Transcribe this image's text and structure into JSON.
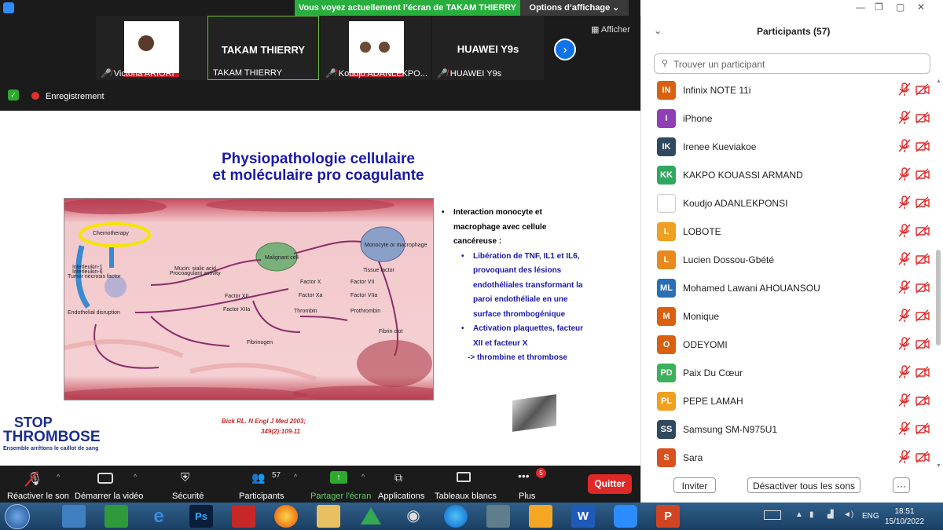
{
  "topbar": {
    "share_banner": "Vous voyez actuellement l’écran de TAKAM THIERRY",
    "view_options": "Options d’affichage"
  },
  "thumbnails": [
    {
      "name": "Victoria ARIORI"
    },
    {
      "name": "TAKAM THIERRY",
      "big": "TAKAM THIERRY"
    },
    {
      "name": "Koudjo ADANLEKPO..."
    },
    {
      "name": "HUAWEI Y9s",
      "big": "HUAWEI Y9s"
    }
  ],
  "afficher": "Afficher",
  "recording": "Enregistrement",
  "slide": {
    "title_line1": "Physiopathologie cellulaire",
    "title_line2": "et moléculaire pro coagulante",
    "diagram_labels": {
      "chemo": "Chemotherapy",
      "il1": "Interleukin-1",
      "il6": "Interleukin-6",
      "tnf": "Tumor necrosis factor",
      "endo": "Endothelial disruption",
      "mucin": "Mucin: sialic acid",
      "procoag": "Procoagulant activity",
      "malignant": "Malignant cell",
      "monocyte": "Monocyte or macrophage",
      "tissue": "Tissue factor",
      "fx": "Factor X",
      "fvii": "Factor VII",
      "fxa": "Factor Xa",
      "fviia": "Factor VIIa",
      "fxii": "Factor XII",
      "fxiia": "Factor XIIa",
      "thrombin": "Thrombin",
      "prothrombin": "Prothrombin",
      "fibrinogen": "Fibrinogen",
      "fibrin": "Fibrin clot"
    },
    "bullet1": "Interaction monocyte et macrophage avec cellule cancéreuse :",
    "sub1": "Libération de TNF, IL1 et IL6, provoquant des lésions endothéliales transformant la paroi endothéliale en une surface thrombogénique",
    "sub2": "Activation plaquettes, facteur XII et facteur X",
    "arrow_text": "-> thrombine et thrombose",
    "citation1": "Bick RL. N Engl J Med 2003;",
    "citation2": "349(2):109-11",
    "logo_line1": "STOP",
    "logo_line2": "THROMBOSE",
    "logo_tagline": "Ensemble arrêtons le caillot de sang"
  },
  "toolbar": {
    "mute": "Réactiver le son",
    "video": "Démarrer la vidéo",
    "security": "Sécurité",
    "participants": "Participants",
    "participants_count": "57",
    "share": "Partager l'écran",
    "apps": "Applications",
    "whiteboards": "Tableaux blancs",
    "more": "Plus",
    "more_badge": "5",
    "quit": "Quitter"
  },
  "panel": {
    "title": "Participants (57)",
    "search_placeholder": "Trouver un participant",
    "participants": [
      {
        "initials": "IN",
        "name": "Infinix NOTE 11i",
        "color": "#d9600f"
      },
      {
        "initials": "I",
        "name": "iPhone",
        "color": "#8e3fb5"
      },
      {
        "initials": "IK",
        "name": "Irenee Kueviakoe",
        "color": "#2f4a5f"
      },
      {
        "initials": "KK",
        "name": "KAKPO KOUASSI ARMAND",
        "color": "#2ea85f"
      },
      {
        "initials": "",
        "name": "Koudjo ADANLEKPONSI",
        "color": "#ffffff"
      },
      {
        "initials": "L",
        "name": "LOBOTE",
        "color": "#f0a020"
      },
      {
        "initials": "L",
        "name": "Lucien Dossou-Gbété",
        "color": "#e8891e"
      },
      {
        "initials": "ML",
        "name": "Mohamed Lawani AHOUANSOU",
        "color": "#2a6fb3"
      },
      {
        "initials": "M",
        "name": "Monique",
        "color": "#d9600f"
      },
      {
        "initials": "O",
        "name": "ODEYOMI",
        "color": "#d9600f"
      },
      {
        "initials": "PD",
        "name": "Paix Du Cœur",
        "color": "#3cb15a"
      },
      {
        "initials": "PL",
        "name": "PEPE LAMAH",
        "color": "#f0a020"
      },
      {
        "initials": "SS",
        "name": "Samsung SM-N975U1",
        "color": "#2f4a5f"
      },
      {
        "initials": "S",
        "name": "Sara",
        "color": "#d9501f"
      }
    ],
    "invite": "Inviter",
    "mute_all": "Désactiver tous les sons",
    "more": "···"
  },
  "taskbar": {
    "lang": "ENG",
    "time": "18:51",
    "date": "15/10/2022"
  }
}
